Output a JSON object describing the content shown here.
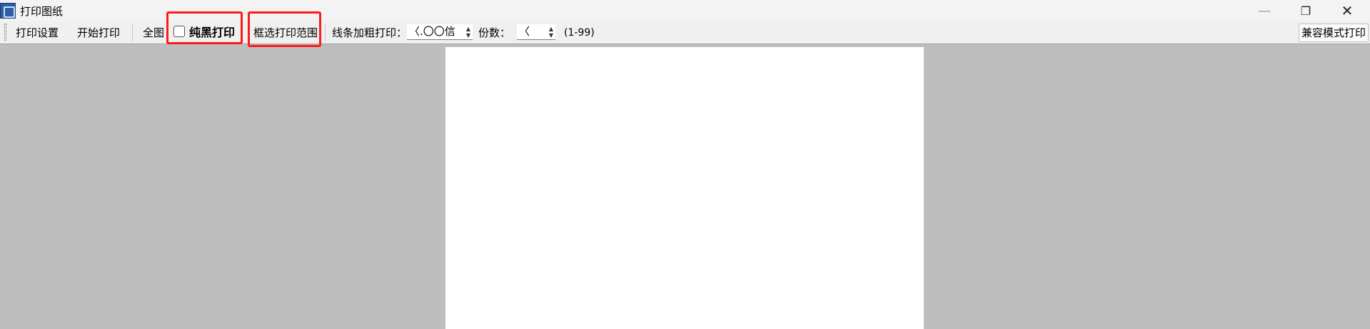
{
  "window": {
    "title": "打印图纸",
    "minimize_glyph": "—",
    "restore_glyph": "❐",
    "close_glyph": "✕"
  },
  "toolbar": {
    "print_settings": "打印设置",
    "start_print": "开始打印",
    "full_view": "全图",
    "pure_black_label": "纯黑打印",
    "pure_black_checked": false,
    "select_range": "框选打印范围",
    "line_bold_label": "线条加粗打印：",
    "line_bold_value": "〈.〇〇信",
    "copies_label": "份数：",
    "copies_value": "〈",
    "copies_range": "(1-99)",
    "compat_mode": "兼容模式打印"
  },
  "colors": {
    "highlight": "#ff1a1a",
    "workspace": "#bebebe",
    "paper": "#ffffff"
  }
}
